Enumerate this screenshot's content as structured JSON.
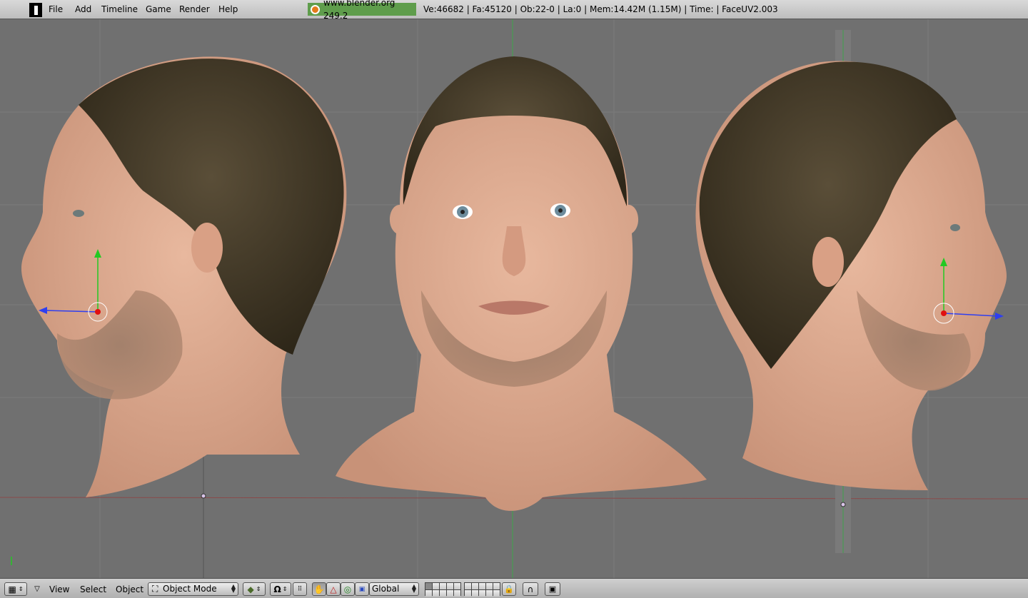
{
  "menu": {
    "items": [
      "File",
      "Add",
      "Timeline",
      "Game",
      "Render",
      "Help"
    ]
  },
  "info": {
    "version_badge": "www.blender.org 249.2",
    "stats": "Ve:46682 | Fa:45120 | Ob:22-0 | La:0  | Mem:14.42M (1.15M)  | Time: | FaceUV2.003"
  },
  "viewport_header": {
    "view_label": "View",
    "select_label": "Select",
    "object_label": "Object",
    "mode": "Object Mode",
    "orientation": "Global"
  },
  "colors": {
    "badge": "#5f9d4c",
    "viewport_bg": "#707070",
    "grid_line": "#7b7b7b",
    "axis_x": "#8a4a4a",
    "axis_z": "#3fa34a",
    "manip_y": "#22c922",
    "manip_x": "#2f3ff0",
    "pivot": "#e01010",
    "skin": "#d9a88c",
    "hair": "#3f3626"
  },
  "icons": {
    "editor_type": "grid-icon",
    "menu_toggle": "triangle-down-icon",
    "mode_icon": "object-mode-icon",
    "shading": "shading-cube-icon",
    "pivot": "pivot-icon",
    "manipulator_hand": "hand-icon",
    "manipulator_translate": "translate-icon",
    "manipulator_rotate": "rotate-icon",
    "manipulator_scale": "scale-icon",
    "lock": "lock-icon",
    "snap": "magnet-icon",
    "render": "render-icon"
  }
}
